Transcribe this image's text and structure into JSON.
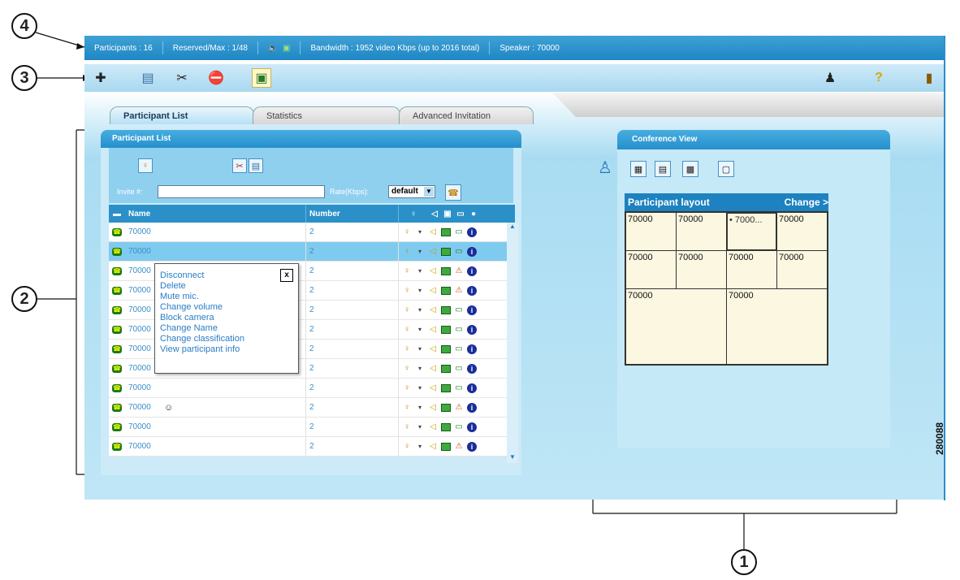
{
  "callouts": [
    "4",
    "3",
    "2",
    "1"
  ],
  "status": {
    "participants": "Participants : 16",
    "reserved": "Reserved/Max : 1/48",
    "bandwidth": "Bandwidth : 1952 video Kbps (up to 2016 total)",
    "speaker": "Speaker : 70000"
  },
  "toolbar": {
    "left": [
      "add-participant-icon",
      "document-icon",
      "tools-icon",
      "stop-icon",
      "video-icon"
    ],
    "right": [
      "user-icon",
      "help-icon",
      "exit-icon"
    ]
  },
  "tabs": [
    "Participant List",
    "Statistics",
    "Advanced Invitation"
  ],
  "participant_panel": {
    "title": "Participant List",
    "invite_label": "Invite #:",
    "rate_label": "Rate(Kbps):",
    "rate_value": "default",
    "columns": {
      "name": "Name",
      "number": "Number"
    },
    "rows": [
      {
        "name": "70000",
        "number": "2"
      },
      {
        "name": "70000",
        "number": "2"
      },
      {
        "name": "70000",
        "number": "2"
      },
      {
        "name": "70000",
        "number": "2"
      },
      {
        "name": "70000",
        "number": "2"
      },
      {
        "name": "70000",
        "number": "2"
      },
      {
        "name": "70000",
        "number": "2"
      },
      {
        "name": "70000",
        "number": "2"
      },
      {
        "name": "70000",
        "number": "2"
      },
      {
        "name": "70000",
        "number": "2"
      },
      {
        "name": "70000",
        "number": "2"
      },
      {
        "name": "70000",
        "number": "2"
      }
    ]
  },
  "context_menu": {
    "close": "x",
    "items": [
      "Disconnect",
      "Delete",
      "Mute mic.",
      "Change volume",
      "Block camera",
      "Change Name",
      "Change classification",
      "View participant info"
    ]
  },
  "conference_view": {
    "title": "Conference View",
    "layout_label": "Participant layout",
    "change_label": "Change >",
    "cells": [
      "70000",
      "70000",
      "• 7000...",
      "70000",
      "70000",
      "70000",
      "70000",
      "70000",
      "70000",
      "70000"
    ]
  },
  "figure_id": "280088"
}
